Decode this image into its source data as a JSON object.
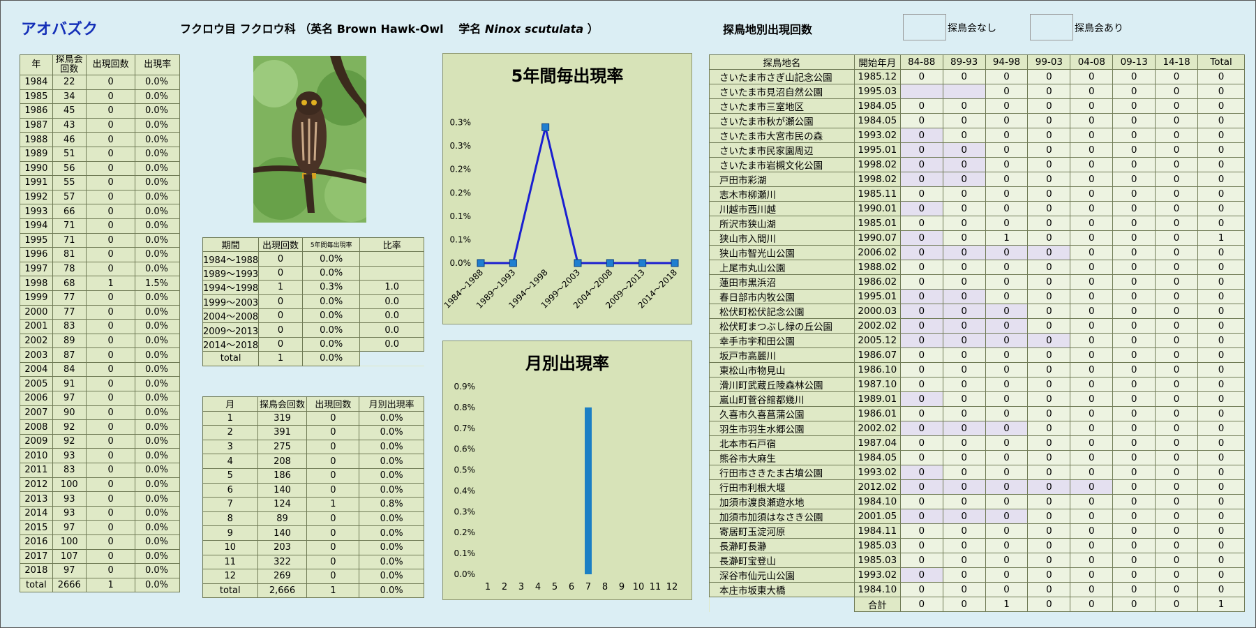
{
  "header": {
    "species": "アオバズク",
    "taxonomy": "フクロウ目 フクロウ科 （英名 Brown Hawk-Owl　 学名",
    "scientific": "Ninox scutulata",
    "close": "）"
  },
  "site_section": {
    "title": "探鳥地別出現回数",
    "legend_none": "探鳥会なし",
    "legend_yes": "探鳥会あり",
    "color_none": "#e4e0f0",
    "color_yes": "#edf3e1"
  },
  "year_table": {
    "headers": [
      "年",
      "探鳥会回数",
      "出現回数",
      "出現率"
    ],
    "rows": [
      [
        "1984",
        "22",
        "0",
        "0.0%"
      ],
      [
        "1985",
        "34",
        "0",
        "0.0%"
      ],
      [
        "1986",
        "45",
        "0",
        "0.0%"
      ],
      [
        "1987",
        "43",
        "0",
        "0.0%"
      ],
      [
        "1988",
        "46",
        "0",
        "0.0%"
      ],
      [
        "1989",
        "51",
        "0",
        "0.0%"
      ],
      [
        "1990",
        "56",
        "0",
        "0.0%"
      ],
      [
        "1991",
        "55",
        "0",
        "0.0%"
      ],
      [
        "1992",
        "57",
        "0",
        "0.0%"
      ],
      [
        "1993",
        "66",
        "0",
        "0.0%"
      ],
      [
        "1994",
        "71",
        "0",
        "0.0%"
      ],
      [
        "1995",
        "71",
        "0",
        "0.0%"
      ],
      [
        "1996",
        "81",
        "0",
        "0.0%"
      ],
      [
        "1997",
        "78",
        "0",
        "0.0%"
      ],
      [
        "1998",
        "68",
        "1",
        "1.5%"
      ],
      [
        "1999",
        "77",
        "0",
        "0.0%"
      ],
      [
        "2000",
        "77",
        "0",
        "0.0%"
      ],
      [
        "2001",
        "83",
        "0",
        "0.0%"
      ],
      [
        "2002",
        "89",
        "0",
        "0.0%"
      ],
      [
        "2003",
        "87",
        "0",
        "0.0%"
      ],
      [
        "2004",
        "84",
        "0",
        "0.0%"
      ],
      [
        "2005",
        "91",
        "0",
        "0.0%"
      ],
      [
        "2006",
        "97",
        "0",
        "0.0%"
      ],
      [
        "2007",
        "90",
        "0",
        "0.0%"
      ],
      [
        "2008",
        "92",
        "0",
        "0.0%"
      ],
      [
        "2009",
        "92",
        "0",
        "0.0%"
      ],
      [
        "2010",
        "93",
        "0",
        "0.0%"
      ],
      [
        "2011",
        "83",
        "0",
        "0.0%"
      ],
      [
        "2012",
        "100",
        "0",
        "0.0%"
      ],
      [
        "2013",
        "93",
        "0",
        "0.0%"
      ],
      [
        "2014",
        "93",
        "0",
        "0.0%"
      ],
      [
        "2015",
        "97",
        "0",
        "0.0%"
      ],
      [
        "2016",
        "100",
        "0",
        "0.0%"
      ],
      [
        "2017",
        "107",
        "0",
        "0.0%"
      ],
      [
        "2018",
        "97",
        "0",
        "0.0%"
      ],
      [
        "total",
        "2666",
        "1",
        "0.0%"
      ]
    ]
  },
  "period_table": {
    "headers": [
      "期間",
      "出現回数",
      "5年間毎出現率",
      "比率"
    ],
    "rows": [
      [
        "1984～1988",
        "0",
        "0.0%",
        ""
      ],
      [
        "1989～1993",
        "0",
        "0.0%",
        ""
      ],
      [
        "1994～1998",
        "1",
        "0.3%",
        "1.0"
      ],
      [
        "1999～2003",
        "0",
        "0.0%",
        "0.0"
      ],
      [
        "2004～2008",
        "0",
        "0.0%",
        "0.0"
      ],
      [
        "2009～2013",
        "0",
        "0.0%",
        "0.0"
      ],
      [
        "2014～2018",
        "0",
        "0.0%",
        "0.0"
      ]
    ],
    "total": [
      "total",
      "1",
      "0.0%"
    ]
  },
  "month_table": {
    "headers": [
      "月",
      "探鳥会回数",
      "出現回数",
      "月別出現率"
    ],
    "rows": [
      [
        "1",
        "319",
        "0",
        "0.0%"
      ],
      [
        "2",
        "391",
        "0",
        "0.0%"
      ],
      [
        "3",
        "275",
        "0",
        "0.0%"
      ],
      [
        "4",
        "208",
        "0",
        "0.0%"
      ],
      [
        "5",
        "186",
        "0",
        "0.0%"
      ],
      [
        "6",
        "140",
        "0",
        "0.0%"
      ],
      [
        "7",
        "124",
        "1",
        "0.8%"
      ],
      [
        "8",
        "89",
        "0",
        "0.0%"
      ],
      [
        "9",
        "140",
        "0",
        "0.0%"
      ],
      [
        "10",
        "203",
        "0",
        "0.0%"
      ],
      [
        "11",
        "322",
        "0",
        "0.0%"
      ],
      [
        "12",
        "269",
        "0",
        "0.0%"
      ],
      [
        "total",
        "2,666",
        "1",
        "0.0%"
      ]
    ]
  },
  "site_table": {
    "headers": [
      "探鳥地名",
      "開始年月",
      "84-88",
      "89-93",
      "94-98",
      "99-03",
      "04-08",
      "09-13",
      "14-18",
      "Total"
    ],
    "rows": [
      {
        "name": "さいたま市さぎ山記念公園",
        "start": "1985.12",
        "v": [
          "0",
          "0",
          "0",
          "0",
          "0",
          "0",
          "0",
          "0"
        ],
        "n": []
      },
      {
        "name": "さいたま市見沼自然公園",
        "start": "1995.03",
        "v": [
          "",
          "",
          "0",
          "0",
          "0",
          "0",
          "0",
          "0"
        ],
        "n": [
          0,
          1
        ]
      },
      {
        "name": "さいたま市三室地区",
        "start": "1984.05",
        "v": [
          "0",
          "0",
          "0",
          "0",
          "0",
          "0",
          "0",
          "0"
        ],
        "n": []
      },
      {
        "name": "さいたま市秋が瀬公園",
        "start": "1984.05",
        "v": [
          "0",
          "0",
          "0",
          "0",
          "0",
          "0",
          "0",
          "0"
        ],
        "n": []
      },
      {
        "name": "さいたま市大宮市民の森",
        "start": "1993.02",
        "v": [
          "0",
          "0",
          "0",
          "0",
          "0",
          "0",
          "0",
          "0"
        ],
        "n": [
          0
        ]
      },
      {
        "name": "さいたま市民家園周辺",
        "start": "1995.01",
        "v": [
          "0",
          "0",
          "0",
          "0",
          "0",
          "0",
          "0",
          "0"
        ],
        "n": [
          0,
          1
        ]
      },
      {
        "name": "さいたま市岩槻文化公園",
        "start": "1998.02",
        "v": [
          "0",
          "0",
          "0",
          "0",
          "0",
          "0",
          "0",
          "0"
        ],
        "n": [
          0,
          1
        ]
      },
      {
        "name": "戸田市彩湖",
        "start": "1998.02",
        "v": [
          "0",
          "0",
          "0",
          "0",
          "0",
          "0",
          "0",
          "0"
        ],
        "n": [
          0,
          1
        ]
      },
      {
        "name": "志木市柳瀬川",
        "start": "1985.11",
        "v": [
          "0",
          "0",
          "0",
          "0",
          "0",
          "0",
          "0",
          "0"
        ],
        "n": []
      },
      {
        "name": "川越市西川越",
        "start": "1990.01",
        "v": [
          "0",
          "0",
          "0",
          "0",
          "0",
          "0",
          "0",
          "0"
        ],
        "n": [
          0
        ]
      },
      {
        "name": "所沢市狭山湖",
        "start": "1985.01",
        "v": [
          "0",
          "0",
          "0",
          "0",
          "0",
          "0",
          "0",
          "0"
        ],
        "n": []
      },
      {
        "name": "狭山市入間川",
        "start": "1990.07",
        "v": [
          "0",
          "0",
          "1",
          "0",
          "0",
          "0",
          "0",
          "1"
        ],
        "n": [
          0
        ]
      },
      {
        "name": "狭山市智光山公園",
        "start": "2006.02",
        "v": [
          "0",
          "0",
          "0",
          "0",
          "0",
          "0",
          "0",
          "0"
        ],
        "n": [
          0,
          1,
          2,
          3
        ]
      },
      {
        "name": "上尾市丸山公園",
        "start": "1988.02",
        "v": [
          "0",
          "0",
          "0",
          "0",
          "0",
          "0",
          "0",
          "0"
        ],
        "n": []
      },
      {
        "name": "蓮田市黒浜沼",
        "start": "1986.02",
        "v": [
          "0",
          "0",
          "0",
          "0",
          "0",
          "0",
          "0",
          "0"
        ],
        "n": []
      },
      {
        "name": "春日部市内牧公園",
        "start": "1995.01",
        "v": [
          "0",
          "0",
          "0",
          "0",
          "0",
          "0",
          "0",
          "0"
        ],
        "n": [
          0,
          1
        ]
      },
      {
        "name": "松伏町松伏記念公園",
        "start": "2000.03",
        "v": [
          "0",
          "0",
          "0",
          "0",
          "0",
          "0",
          "0",
          "0"
        ],
        "n": [
          0,
          1,
          2
        ]
      },
      {
        "name": "松伏町まつぶし緑の丘公園",
        "start": "2002.02",
        "v": [
          "0",
          "0",
          "0",
          "0",
          "0",
          "0",
          "0",
          "0"
        ],
        "n": [
          0,
          1,
          2
        ]
      },
      {
        "name": "幸手市宇和田公園",
        "start": "2005.12",
        "v": [
          "0",
          "0",
          "0",
          "0",
          "0",
          "0",
          "0",
          "0"
        ],
        "n": [
          0,
          1,
          2,
          3
        ]
      },
      {
        "name": "坂戸市高麗川",
        "start": "1986.07",
        "v": [
          "0",
          "0",
          "0",
          "0",
          "0",
          "0",
          "0",
          "0"
        ],
        "n": []
      },
      {
        "name": "東松山市物見山",
        "start": "1986.10",
        "v": [
          "0",
          "0",
          "0",
          "0",
          "0",
          "0",
          "0",
          "0"
        ],
        "n": []
      },
      {
        "name": "滑川町武蔵丘陵森林公園",
        "start": "1987.10",
        "v": [
          "0",
          "0",
          "0",
          "0",
          "0",
          "0",
          "0",
          "0"
        ],
        "n": []
      },
      {
        "name": "嵐山町菅谷館都幾川",
        "start": "1989.01",
        "v": [
          "0",
          "0",
          "0",
          "0",
          "0",
          "0",
          "0",
          "0"
        ],
        "n": [
          0
        ]
      },
      {
        "name": "久喜市久喜菖蒲公園",
        "start": "1986.01",
        "v": [
          "0",
          "0",
          "0",
          "0",
          "0",
          "0",
          "0",
          "0"
        ],
        "n": []
      },
      {
        "name": "羽生市羽生水郷公園",
        "start": "2002.02",
        "v": [
          "0",
          "0",
          "0",
          "0",
          "0",
          "0",
          "0",
          "0"
        ],
        "n": [
          0,
          1,
          2
        ]
      },
      {
        "name": "北本市石戸宿",
        "start": "1987.04",
        "v": [
          "0",
          "0",
          "0",
          "0",
          "0",
          "0",
          "0",
          "0"
        ],
        "n": []
      },
      {
        "name": "熊谷市大麻生",
        "start": "1984.05",
        "v": [
          "0",
          "0",
          "0",
          "0",
          "0",
          "0",
          "0",
          "0"
        ],
        "n": []
      },
      {
        "name": "行田市さきたま古墳公園",
        "start": "1993.02",
        "v": [
          "0",
          "0",
          "0",
          "0",
          "0",
          "0",
          "0",
          "0"
        ],
        "n": [
          0
        ]
      },
      {
        "name": "行田市利根大堰",
        "start": "2012.02",
        "v": [
          "0",
          "0",
          "0",
          "0",
          "0",
          "0",
          "0",
          "0"
        ],
        "n": [
          0,
          1,
          2,
          3,
          4
        ]
      },
      {
        "name": "加須市渡良瀬遊水地",
        "start": "1984.10",
        "v": [
          "0",
          "0",
          "0",
          "0",
          "0",
          "0",
          "0",
          "0"
        ],
        "n": []
      },
      {
        "name": "加須市加須はなさき公園",
        "start": "2001.05",
        "v": [
          "0",
          "0",
          "0",
          "0",
          "0",
          "0",
          "0",
          "0"
        ],
        "n": [
          0,
          1,
          2
        ]
      },
      {
        "name": "寄居町玉淀河原",
        "start": "1984.11",
        "v": [
          "0",
          "0",
          "0",
          "0",
          "0",
          "0",
          "0",
          "0"
        ],
        "n": []
      },
      {
        "name": "長瀞町長瀞",
        "start": "1985.03",
        "v": [
          "0",
          "0",
          "0",
          "0",
          "0",
          "0",
          "0",
          "0"
        ],
        "n": []
      },
      {
        "name": "長瀞町宝登山",
        "start": "1985.03",
        "v": [
          "0",
          "0",
          "0",
          "0",
          "0",
          "0",
          "0",
          "0"
        ],
        "n": []
      },
      {
        "name": "深谷市仙元山公園",
        "start": "1993.02",
        "v": [
          "0",
          "0",
          "0",
          "0",
          "0",
          "0",
          "0",
          "0"
        ],
        "n": [
          0
        ]
      },
      {
        "name": "本庄市坂東大橋",
        "start": "1984.10",
        "v": [
          "0",
          "0",
          "0",
          "0",
          "0",
          "0",
          "0",
          "0"
        ],
        "n": []
      }
    ],
    "total_label": "合計",
    "totals": [
      "0",
      "0",
      "1",
      "0",
      "0",
      "0",
      "0",
      "1"
    ]
  },
  "chart_data": [
    {
      "type": "line",
      "title": "5年間毎出現率",
      "categories": [
        "1984～1988",
        "1989～1993",
        "1994～1998",
        "1999～2003",
        "2004～2008",
        "2009～2013",
        "2014～2018"
      ],
      "values": [
        0.0,
        0.0,
        0.29,
        0.0,
        0.0,
        0.0,
        0.0
      ],
      "unit": "%",
      "ylim": [
        0,
        0.35
      ],
      "yticks": [
        "0.0%",
        "0.1%",
        "0.1%",
        "0.2%",
        "0.2%",
        "0.3%",
        "0.3%"
      ],
      "color": "#1a1fd0",
      "marker_color": "#1f7fd0",
      "grid": true
    },
    {
      "type": "bar",
      "title": "月別出現率",
      "categories": [
        "1",
        "2",
        "3",
        "4",
        "5",
        "6",
        "7",
        "8",
        "9",
        "10",
        "11",
        "12"
      ],
      "values": [
        0,
        0,
        0,
        0,
        0,
        0,
        0.8,
        0,
        0,
        0,
        0,
        0
      ],
      "unit": "%",
      "ylim": [
        0,
        0.9
      ],
      "yticks": [
        "0.0%",
        "0.1%",
        "0.2%",
        "0.3%",
        "0.4%",
        "0.5%",
        "0.6%",
        "0.7%",
        "0.8%",
        "0.9%"
      ],
      "color": "#1b7fc4",
      "grid": true
    }
  ]
}
